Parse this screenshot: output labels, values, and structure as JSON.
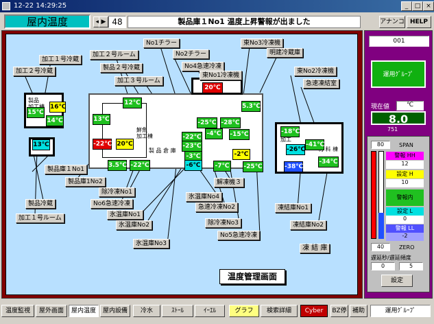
{
  "window": {
    "title": "12-22 14:29:25",
    "btn_min": "_",
    "btn_max": "□",
    "btn_close": "×"
  },
  "header": {
    "screen_name": "屋内温度",
    "nav_prev": "◀",
    "nav_next": "▶",
    "page_no": "48",
    "alarm_message": "製品庫１No1 温度上昇警報が出ました",
    "btn_annunciator": "アナンコ",
    "btn_help": "HELP"
  },
  "plan": {
    "labels": {
      "l1": "加工１号冷蔵",
      "l2": "加工２号冷蔵",
      "l3": "加工２号ルーム",
      "l4": "製品２号冷蔵",
      "l5": "加工３号ルーム",
      "l6": "No1チラー",
      "l7": "No2チラー",
      "l8": "No4急速冷凍",
      "l9": "東No1冷凍機",
      "l10": "東No3冷凍機",
      "l11": "明建冷蔵庫",
      "l12": "東No2冷凍機",
      "l13": "急速凍結室",
      "l14": "製品庫１No1",
      "l15": "製品庫1No2",
      "l16": "除冷凍No1",
      "l17": "No6急速冷凍",
      "l18": "氷温庫No1",
      "l19": "氷温庫No2",
      "l20": "氷温庫No3",
      "l21": "解凍機３",
      "l22": "氷温庫No4",
      "l23": "急速冷凍No2",
      "l24": "除冷凍No3",
      "l25": "No5急速冷凍",
      "l26": "凍結庫No1",
      "l27": "凍結庫No2",
      "l28": "凍 結 庫",
      "l29": "製品冷蔵",
      "l30": "加工１号ルーム"
    },
    "temps": {
      "t1": "16℃",
      "t2": "15℃",
      "t3": "14℃",
      "t4": "13℃",
      "t5": "12℃",
      "t6": "13℃",
      "t7": "-22℃",
      "t8": "20℃",
      "t9": "3.5℃",
      "t10": "-22℃",
      "t11": "20℃",
      "t12": "5.3℃",
      "t13": "-25℃",
      "t14": "-28℃",
      "t15": "-4℃",
      "t16": "-15℃",
      "t17": "-22℃",
      "t18": "-23℃",
      "t19": "-3℃",
      "t20": "-2℃",
      "t21": "-6℃",
      "t22": "-7℃",
      "t23": "-25℃",
      "t24": "-18℃",
      "t25": "-26℃",
      "t26": "-41℃",
      "t27": "-38℃",
      "t28": "-34℃"
    },
    "room_labels": {
      "r1": "製品\n加工棟",
      "r2": "鮮魚\n加工棟",
      "r3": "製 品 倉 庫",
      "r4": "冷凍\n加工",
      "r5": "材 料 棟"
    },
    "panel_title": "温度管理画面"
  },
  "side": {
    "tag": "001",
    "mode_btn": "運用ｸﾞﾙｰﾌﾟ",
    "current_label": "現在値",
    "current_unit": "℃",
    "current_value": "8.0",
    "current_sub": "751",
    "span_value": "80",
    "span_label": "SPAN",
    "alarm_hh_label": "警報 HH",
    "alarm_hh": "12",
    "setpoint_h_label": "設定 H",
    "setpoint_h": "10",
    "in_alarm": "警報内",
    "setpoint_l_label": "設定 L",
    "setpoint_l": "0",
    "alarm_ll_label": "警報 LL",
    "alarm_ll": "-2",
    "zero_value": "40",
    "zero_label": "ZERO",
    "delay_label": "遅延秒/遅延頻度",
    "delay_a": "0",
    "delay_b": "5",
    "setting_btn": "設定"
  },
  "bottom": {
    "b1": "温度監視",
    "b2": "屋外画面",
    "b3": "屋内温度",
    "b4": "屋内設備",
    "b5": "冷水",
    "b6": "ｽﾄｰﾙ",
    "b7": "ｲｰｴﾙ",
    "b8": "グラフ",
    "b9": "検索詳細",
    "b10": "Cyber",
    "b11": "BZ停",
    "b12": "補助",
    "b13": "運用ｸﾞﾙｰﾌﾟ"
  },
  "colors": {
    "screen_name_bg": "#00c0c0",
    "frame": "#800000",
    "canvas": "#b8e0ff",
    "side": "#800080"
  }
}
